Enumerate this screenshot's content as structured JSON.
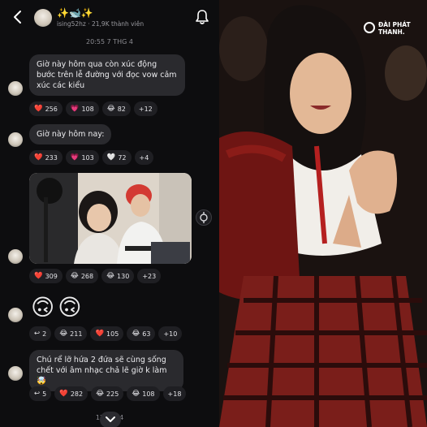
{
  "header": {
    "back_icon": "chevron-left-icon",
    "title": "✨🐋✨",
    "handle": "ising52hz",
    "members": "21,9K thành viên",
    "bell_icon": "bell-icon"
  },
  "timestamps": {
    "top": "20:55 7 THG 4",
    "bottom": "13:2  G 4"
  },
  "messages": [
    {
      "text": "Giờ này hôm qua còn xúc động bước trên lễ đường với đọc vow cảm xúc các kiểu",
      "reactions": [
        {
          "emoji": "❤️",
          "count": "256"
        },
        {
          "emoji": "💗",
          "count": "108"
        },
        {
          "emoji": "😂",
          "count": "82"
        },
        {
          "emoji": "",
          "count": "+12"
        }
      ]
    },
    {
      "text": "Giờ này hôm nay:",
      "reactions": [
        {
          "emoji": "❤️",
          "count": "233"
        },
        {
          "emoji": "💗",
          "count": "103"
        },
        {
          "emoji": "🤍",
          "count": "72"
        },
        {
          "emoji": "",
          "count": "+4"
        }
      ]
    },
    {
      "text": "",
      "reactions": [
        {
          "emoji": "❤️",
          "count": "309"
        },
        {
          "emoji": "😂",
          "count": "268"
        },
        {
          "emoji": "😂",
          "count": "130"
        },
        {
          "emoji": "",
          "count": "+23"
        }
      ]
    },
    {
      "text": "🙃🙃",
      "reactions": [
        {
          "emoji": "↩",
          "count": "2"
        },
        {
          "emoji": "😂",
          "count": "211"
        },
        {
          "emoji": "❤️",
          "count": "105"
        },
        {
          "emoji": "😂",
          "count": "63"
        },
        {
          "emoji": "",
          "count": "+10"
        }
      ]
    },
    {
      "text": "Chú rể lỡ hứa 2 đứa sẽ cùng sống chết với âm nhạc chả lẽ giờ k làm 🤯",
      "reactions": [
        {
          "emoji": "↩",
          "count": "5"
        },
        {
          "emoji": "❤️",
          "count": "282"
        },
        {
          "emoji": "😂",
          "count": "225"
        },
        {
          "emoji": "😂",
          "count": "108"
        },
        {
          "emoji": "",
          "count": "+18"
        }
      ]
    }
  ],
  "brand": {
    "line1": "ĐÀI PHÁT",
    "line2": "THANH."
  },
  "colors": {
    "chat_bg": "#0d0d0f",
    "bubble_bg": "#2a2a2e",
    "chip_bg": "#1f1f23"
  }
}
